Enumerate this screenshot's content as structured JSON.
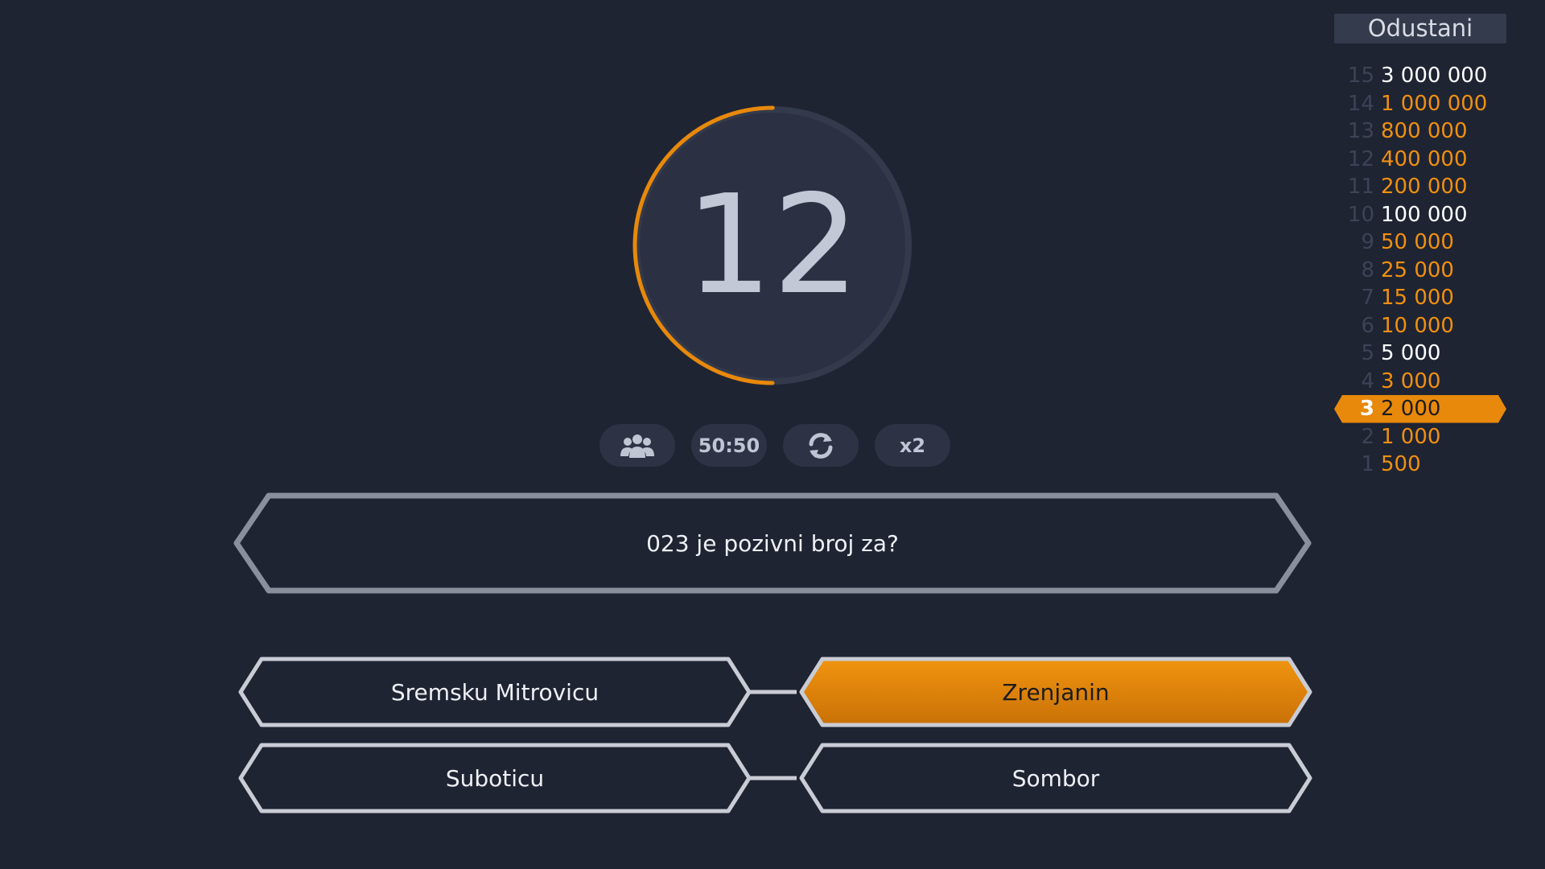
{
  "quit_button": "Odustani",
  "timer": {
    "seconds": "12",
    "remaining_fraction": 0.5
  },
  "ladder": [
    {
      "level": "15",
      "amount": "3 000 000",
      "safe": true
    },
    {
      "level": "14",
      "amount": "1 000 000",
      "safe": false
    },
    {
      "level": "13",
      "amount": "800 000",
      "safe": false
    },
    {
      "level": "12",
      "amount": "400 000",
      "safe": false
    },
    {
      "level": "11",
      "amount": "200 000",
      "safe": false
    },
    {
      "level": "10",
      "amount": "100 000",
      "safe": true
    },
    {
      "level": "9",
      "amount": "50 000",
      "safe": false
    },
    {
      "level": "8",
      "amount": "25 000",
      "safe": false
    },
    {
      "level": "7",
      "amount": "15 000",
      "safe": false
    },
    {
      "level": "6",
      "amount": "10 000",
      "safe": false
    },
    {
      "level": "5",
      "amount": "5 000",
      "safe": true
    },
    {
      "level": "4",
      "amount": "3 000",
      "safe": false
    },
    {
      "level": "3",
      "amount": "2 000",
      "safe": false,
      "current": true
    },
    {
      "level": "2",
      "amount": "1 000",
      "safe": false
    },
    {
      "level": "1",
      "amount": "500",
      "safe": false
    }
  ],
  "lifelines": {
    "audience_icon": "people-icon",
    "fifty_fifty": "50:50",
    "switch_icon": "refresh-icon",
    "double_dip": "x2"
  },
  "question": "023 je pozivni broj za?",
  "answers": {
    "a": "Sremsku Mitrovicu",
    "b": "Zrenjanin",
    "c": "Suboticu",
    "d": "Sombor"
  },
  "selected_answer": "b",
  "colors": {
    "background": "#1f2433",
    "accent": "#e8890b",
    "safe_amount": "#ffffff",
    "amount": "#f0900f",
    "level_number": "#3c4357"
  }
}
